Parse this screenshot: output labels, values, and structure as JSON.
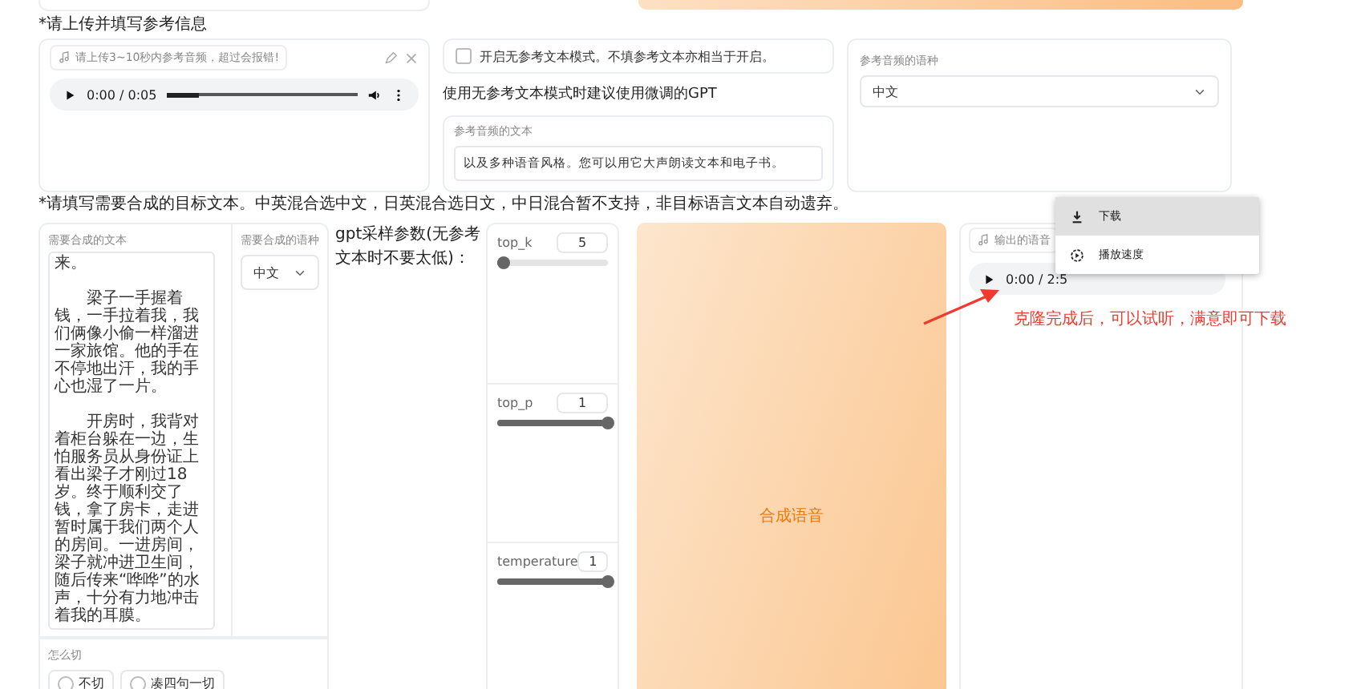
{
  "reference_section": {
    "label": "*请上传并填写参考信息",
    "audio": {
      "label": "请上传3~10秒内参考音频，超过会报错!",
      "time": "0:00 / 0:05",
      "level": 0.17
    },
    "no_text_mode": {
      "label": "开启无参考文本模式。不填参考文本亦相当于开启。",
      "checked": false
    },
    "hint": "使用无参考文本模式时建议使用微调的GPT",
    "ref_text": {
      "label": "参考音频的文本",
      "value": "以及多种语音风格。您可以用它大声朗读文本和电子书。"
    },
    "ref_language": {
      "label": "参考音频的语种",
      "value": "中文"
    }
  },
  "target_section": {
    "label": "*请填写需要合成的目标文本。中英混合选中文，日英混合选日文，中日混合暂不支持，非目标语言文本自动遗弃。",
    "target_text": {
      "label": "需要合成的文本",
      "paragraphs": [
        "来。",
        "梁子一手握着钱，一手拉着我，我们俩像小偷一样溜进一家旅馆。他的手在不停地出汗，我的手心也湿了一片。",
        "开房时，我背对着柜台躲在一边，生怕服务员从身份证上看出梁子才刚过18岁。终于顺利交了钱，拿了房卡，走进暂时属于我们两个人的房间。一进房间，梁子就冲进卫生间，随后传来“哗哗”的水声，十分有力地冲击着我的耳膜。"
      ]
    },
    "target_language": {
      "label": "需要合成的语种",
      "value": "中文"
    },
    "split": {
      "label": "怎么切",
      "options": [
        {
          "label": "不切",
          "selected": false
        },
        {
          "label": "凑四句一切",
          "selected": false
        }
      ]
    },
    "gpt_label": "gpt采样参数(无参考文本时不要太低)：",
    "sliders": [
      {
        "name": "top_k",
        "value": "5",
        "level": 0.06
      },
      {
        "name": "top_p",
        "value": "1",
        "level": 1
      },
      {
        "name": "temperature",
        "value": "1",
        "level": 1
      }
    ],
    "synthesize_button": "合成语音",
    "output": {
      "label": "输出的语音",
      "time": "0:00 / 2:5",
      "menu": [
        {
          "kind": "download",
          "label": "下载",
          "selected": true
        },
        {
          "kind": "speed",
          "label": "播放速度",
          "selected": false
        }
      ]
    }
  },
  "annotation": "克隆完成后，可以试听，满意即可下载"
}
